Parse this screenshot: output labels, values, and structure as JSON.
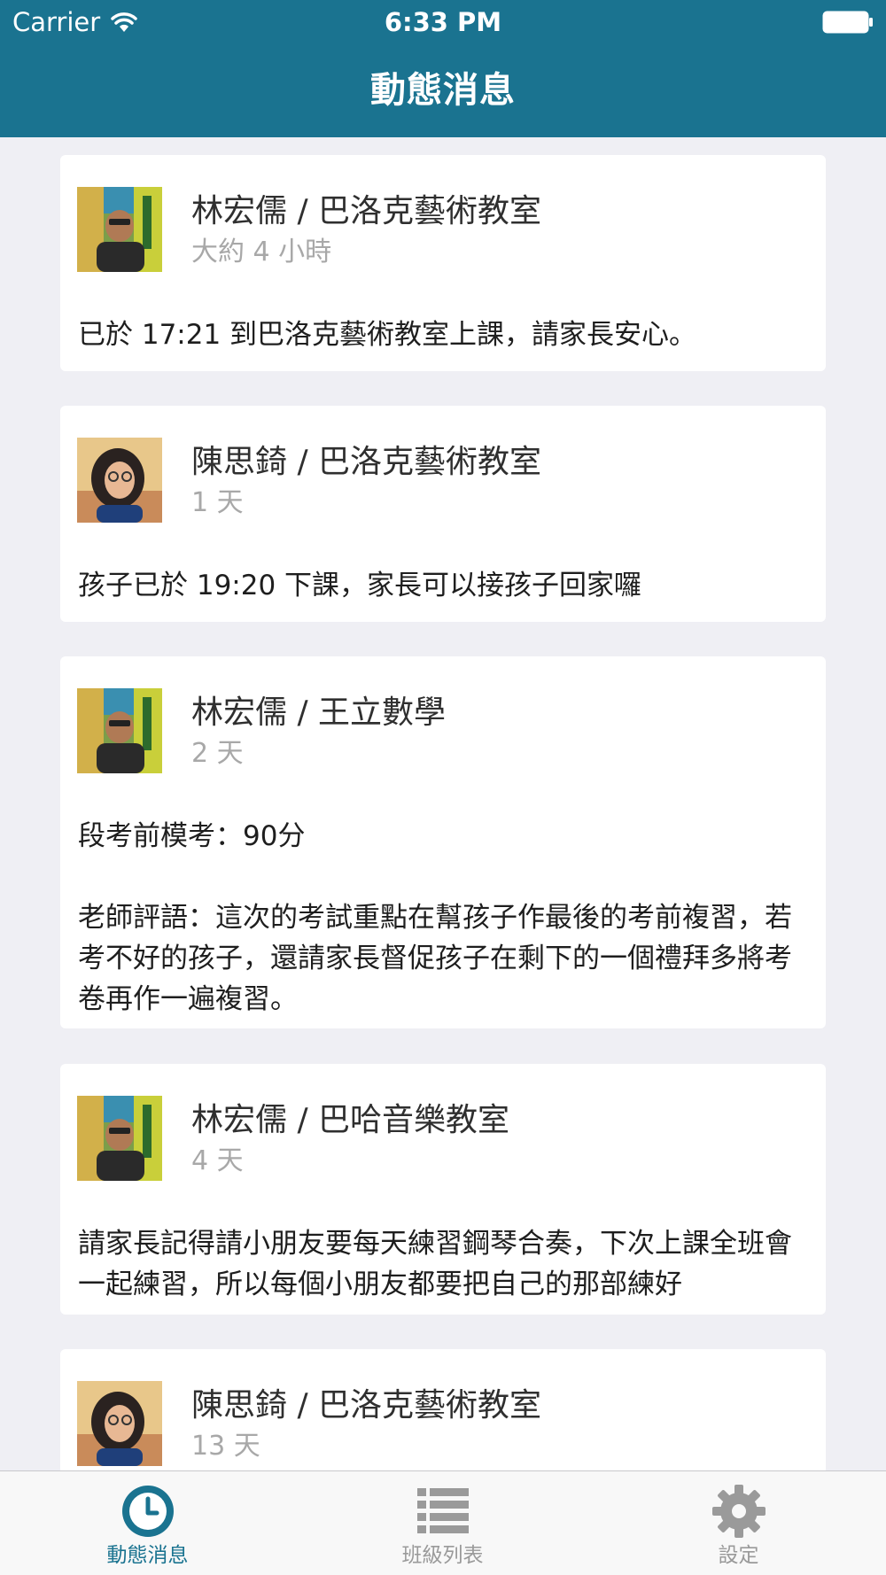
{
  "status_bar": {
    "carrier": "Carrier",
    "time": "6:33 PM"
  },
  "nav": {
    "title": "動態消息"
  },
  "feed": [
    {
      "author": "林宏儒 / 巴洛克藝術教室",
      "ago": "大約 4 小時",
      "message": "已於 17:21 到巴洛克藝術教室上課，請家長安心。",
      "avatar": "teacher-male-photo"
    },
    {
      "author": "陳思錡 / 巴洛克藝術教室",
      "ago": "1 天",
      "message": "孩子已於 19:20 下課，家長可以接孩子回家囉",
      "avatar": "teacher-female-photo"
    },
    {
      "author": "林宏儒 / 王立數學",
      "ago": "2 天",
      "message": "段考前模考：90分\n\n老師評語：這次的考試重點在幫孩子作最後的考前複習，若考不好的孩子，還請家長督促孩子在剩下的一個禮拜多將考卷再作一遍複習。",
      "avatar": "teacher-male-photo"
    },
    {
      "author": "林宏儒 / 巴哈音樂教室",
      "ago": "4 天",
      "message": "請家長記得請小朋友要每天練習鋼琴合奏，下次上課全班會一起練習，所以每個小朋友都要把自己的那部練好",
      "avatar": "teacher-male-photo"
    },
    {
      "author": "陳思錡 / 巴洛克藝術教室",
      "ago": "13 天",
      "message": "",
      "avatar": "teacher-female-photo"
    }
  ],
  "tabs": [
    {
      "label": "動態消息",
      "icon": "clock-icon",
      "active": true
    },
    {
      "label": "班級列表",
      "icon": "list-icon",
      "active": false
    },
    {
      "label": "設定",
      "icon": "gear-icon",
      "active": false
    }
  ],
  "colors": {
    "accent": "#1a7390",
    "background": "#efeff4",
    "inactive_tab": "#9a9a9a"
  }
}
